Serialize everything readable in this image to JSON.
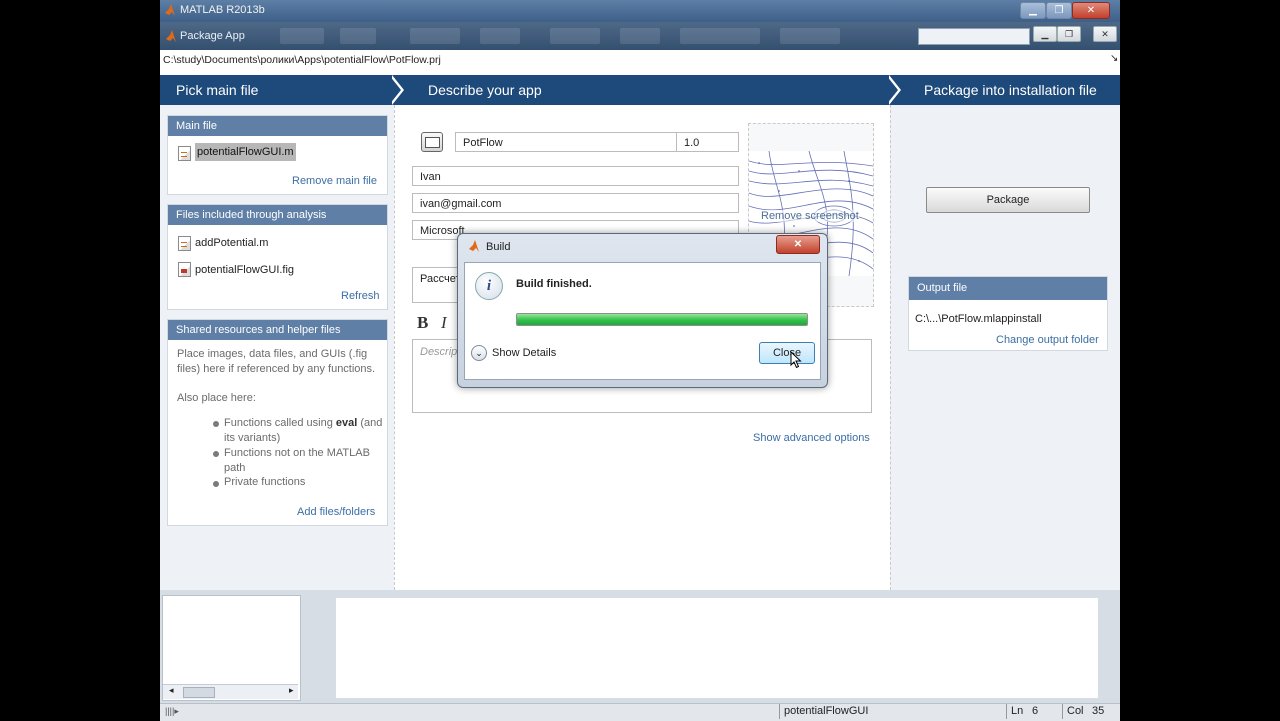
{
  "matlab_window": {
    "title": "MATLAB R2013b",
    "buttons": {
      "minimize": "▁",
      "maximize": "❐",
      "close": "✕"
    }
  },
  "package_window": {
    "title": "Package App",
    "search_placeholder": "",
    "buttons": {
      "minimize": "▁",
      "restore": "❐",
      "close": "✕"
    }
  },
  "path": "C:\\study\\Documents\\ролики\\Apps\\potentialFlow\\PotFlow.prj",
  "steps": [
    "Pick main file",
    "Describe your app",
    "Package into installation file"
  ],
  "left": {
    "main_file": {
      "header": "Main file",
      "file": "potentialFlowGUI.m",
      "remove_link": "Remove main file"
    },
    "analysis": {
      "header": "Files included through analysis",
      "files": [
        "addPotential.m",
        "potentialFlowGUI.fig"
      ],
      "refresh_link": "Refresh"
    },
    "shared": {
      "header": "Shared resources and helper files",
      "desc": "Place images, data files, and GUIs (.fig files) here if referenced by any functions.",
      "also": "Also place here:",
      "bullet1_pre": "Functions called using ",
      "bullet1_bold": "eval",
      "bullet1_post": " (and its variants)",
      "bullet2": "Functions not on the MATLAB path",
      "bullet3": "Private functions",
      "add_link": "Add files/folders"
    }
  },
  "middle": {
    "app_name": "PotFlow",
    "version": "1.0",
    "author": "Ivan",
    "email": "ivan@gmail.com",
    "company": "Microsoft",
    "summary": "Рассчет",
    "bold_btn": "B",
    "italic_btn": "I",
    "description_placeholder": "Descript",
    "remove_screenshot": "Remove screenshot",
    "advanced_link": "Show advanced options"
  },
  "right": {
    "package_button": "Package",
    "output_header": "Output file",
    "output_file": "C:\\...\\PotFlow.mlappinstall",
    "change_folder_link": "Change output folder"
  },
  "dialog": {
    "title": "Build",
    "close_x": "✕",
    "message": "Build finished.",
    "progress": 1.0,
    "details": "Show Details",
    "close_button": "Close"
  },
  "status": {
    "file": "potentialFlowGUI",
    "ln_label": "Ln",
    "ln": "6",
    "col_label": "Col",
    "col": "35"
  },
  "colors": {
    "step_bar": "#1d4a7a",
    "panel_header": "#5f7fa6",
    "progress": "#2fc24a",
    "link": "#3b6ea5"
  }
}
